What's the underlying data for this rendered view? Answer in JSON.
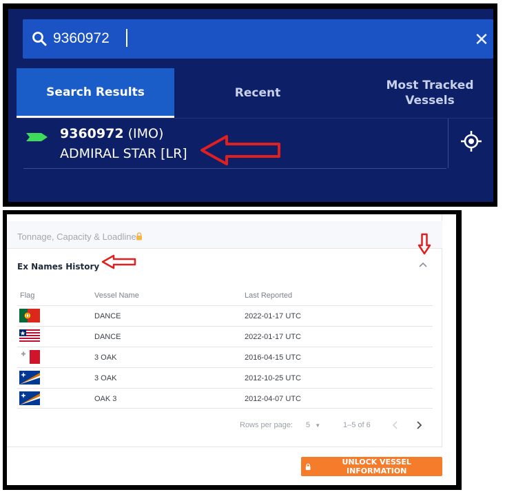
{
  "search": {
    "value": "9360972",
    "clear_icon": "close-icon"
  },
  "tabs": [
    {
      "label": "Search Results",
      "active": true
    },
    {
      "label": "Recent",
      "active": false
    },
    {
      "label": "Most Tracked\nVessels",
      "active": false
    }
  ],
  "result": {
    "id": "9360972",
    "id_type": "(IMO)",
    "name": "ADMIRAL STAR [LR]",
    "marker_color": "#3ddc5a"
  },
  "details": {
    "tonnage_label": "Tonnage, Capacity & Loadline",
    "section_title": "Ex Names History",
    "columns": {
      "flag": "Flag",
      "name": "Vessel Name",
      "date": "Last Reported"
    },
    "rows": [
      {
        "flag": "portugal-flag",
        "name": "DANCE",
        "date": "2022-01-17 UTC"
      },
      {
        "flag": "liberia-flag",
        "name": "DANCE",
        "date": "2022-01-17 UTC"
      },
      {
        "flag": "malta-flag",
        "name": "3 OAK",
        "date": "2016-04-15 UTC"
      },
      {
        "flag": "marshall-islands-flag",
        "name": "3 OAK",
        "date": "2012-10-25 UTC"
      },
      {
        "flag": "marshall-islands-flag",
        "name": "OAK 3",
        "date": "2012-04-07 UTC"
      }
    ],
    "pagination": {
      "rows_per_page_label": "Rows per page:",
      "rows_per_page": "5",
      "range": "1–5 of 6"
    },
    "unlock_label": "UNLOCK VESSEL INFORMATION"
  },
  "colors": {
    "top_bg": "#0d1f66",
    "search_bar": "#1b52c4",
    "active_tab": "#1a5cc8",
    "unlock_button": "#f57c2b",
    "annotation_arrow": "#e02020"
  }
}
